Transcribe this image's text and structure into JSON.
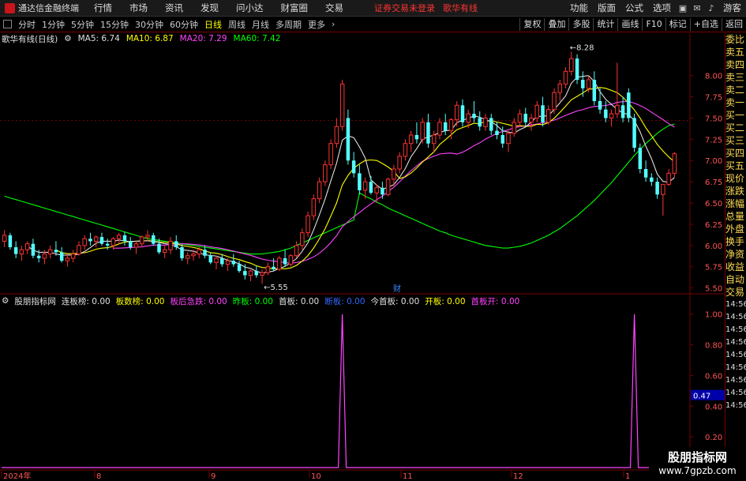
{
  "menubar": {
    "app_title": "通达信金融终端",
    "items": [
      "行情",
      "市场",
      "资讯",
      "发现",
      "问小达",
      "财富圈",
      "交易"
    ],
    "warning": "证券交易未登录",
    "product": "歌华有线",
    "right_items": [
      "功能",
      "版面",
      "公式",
      "选项"
    ],
    "guest": "游客"
  },
  "periodbar": {
    "periods": [
      "分时",
      "1分钟",
      "5分钟",
      "15分钟",
      "30分钟",
      "60分钟",
      "日线",
      "周线",
      "月线",
      "多周期",
      "更多"
    ],
    "active": "日线",
    "tools": [
      "复权",
      "叠加",
      "多股",
      "统计",
      "画线",
      "F10",
      "标记",
      "+自选",
      "返回"
    ]
  },
  "main_legend": {
    "title": "歌华有线(日线)",
    "ma5": "MA5: 6.74",
    "ma10": "MA10: 6.87",
    "ma20": "MA20: 7.29",
    "ma60": "MA60: 7.42"
  },
  "indicator_legend": {
    "title": "股朋指标网",
    "items": [
      {
        "label": "连板榜: 0.00",
        "color": "#e0e0e0"
      },
      {
        "label": "板数榜: 0.00",
        "color": "#ffff00"
      },
      {
        "label": "板后急跌: 0.00",
        "color": "#ff44ff"
      },
      {
        "label": "昨板: 0.00",
        "color": "#00ff00"
      },
      {
        "label": "首板: 0.00",
        "color": "#e0e0e0"
      },
      {
        "label": "断板: 0.00",
        "color": "#3366ff"
      },
      {
        "label": "今首板: 0.00",
        "color": "#e0e0e0"
      },
      {
        "label": "开板: 0.00",
        "color": "#ffff00"
      },
      {
        "label": "首板开: 0.00",
        "color": "#ff44ff"
      }
    ]
  },
  "price_axis": [
    "8.00",
    "7.75",
    "7.50",
    "7.25",
    "7.00",
    "6.75",
    "6.50",
    "6.25",
    "6.00",
    "5.75",
    "5.50"
  ],
  "indicator_axis": [
    "1.00",
    "0.80",
    "0.60",
    "0.40",
    "0.20"
  ],
  "indicator_current": "0.47",
  "date_axis": [
    "2024年",
    "8",
    "9",
    "10",
    "11",
    "12",
    "1"
  ],
  "annotations": {
    "high": "8.28",
    "low": "5.55",
    "event": "财"
  },
  "sidepanel": [
    "委比",
    "卖五",
    "卖四",
    "卖三",
    "卖二",
    "卖一",
    "买一",
    "买二",
    "买三",
    "买四",
    "买五",
    "现价",
    "涨跌",
    "涨幅",
    "总量",
    "外盘",
    "换手",
    "净资",
    "收益",
    "自动",
    "交易"
  ],
  "sidepanel_times": [
    "14:56",
    "14:56",
    "14:56",
    "14:56",
    "14:56",
    "14:56",
    "14:56",
    "14:56",
    "14:56"
  ],
  "watermark": {
    "line1": "股朋指标网",
    "line2": "www.7gpzb.com"
  },
  "colors": {
    "up": "#ff3333",
    "down": "#54ffff",
    "ma5": "#e0e0e0",
    "ma10": "#ffff00",
    "ma20": "#ff44ff",
    "ma60": "#00ff00",
    "signal": "#ff44ff",
    "frame": "#7a0000"
  },
  "chart_data": {
    "type": "candlestick",
    "price_range": [
      5.45,
      8.35
    ],
    "candles": [
      [
        6.05,
        6.18,
        5.98,
        6.12
      ],
      [
        6.12,
        6.15,
        5.95,
        5.98
      ],
      [
        5.98,
        6.05,
        5.85,
        5.9
      ],
      [
        5.9,
        6.0,
        5.82,
        5.95
      ],
      [
        5.95,
        6.05,
        5.9,
        6.02
      ],
      [
        6.02,
        6.08,
        5.85,
        5.88
      ],
      [
        5.88,
        5.95,
        5.8,
        5.85
      ],
      [
        5.85,
        5.95,
        5.78,
        5.9
      ],
      [
        5.9,
        6.0,
        5.85,
        5.95
      ],
      [
        5.95,
        6.05,
        5.88,
        5.92
      ],
      [
        5.92,
        5.98,
        5.8,
        5.82
      ],
      [
        5.82,
        5.9,
        5.75,
        5.85
      ],
      [
        5.85,
        5.95,
        5.8,
        5.9
      ],
      [
        5.9,
        6.05,
        5.88,
        6.0
      ],
      [
        6.0,
        6.12,
        5.95,
        6.08
      ],
      [
        6.08,
        6.15,
        6.0,
        6.05
      ],
      [
        6.05,
        6.12,
        5.98,
        6.1
      ],
      [
        6.1,
        6.15,
        6.0,
        6.02
      ],
      [
        6.02,
        6.08,
        5.95,
        6.0
      ],
      [
        6.0,
        6.1,
        5.95,
        6.08
      ],
      [
        6.08,
        6.15,
        6.02,
        6.12
      ],
      [
        6.12,
        6.16,
        6.0,
        6.05
      ],
      [
        6.05,
        6.1,
        5.95,
        5.98
      ],
      [
        5.98,
        6.05,
        5.9,
        6.02
      ],
      [
        6.02,
        6.12,
        5.98,
        6.1
      ],
      [
        6.1,
        6.18,
        6.05,
        6.12
      ],
      [
        6.12,
        6.15,
        6.0,
        6.02
      ],
      [
        6.02,
        6.08,
        5.9,
        5.92
      ],
      [
        5.92,
        6.0,
        5.85,
        5.95
      ],
      [
        5.95,
        6.1,
        5.9,
        6.05
      ],
      [
        6.05,
        6.12,
        5.95,
        5.98
      ],
      [
        5.98,
        6.02,
        5.82,
        5.85
      ],
      [
        5.85,
        5.92,
        5.78,
        5.88
      ],
      [
        5.88,
        5.95,
        5.82,
        5.9
      ],
      [
        5.9,
        5.98,
        5.85,
        5.95
      ],
      [
        5.95,
        6.0,
        5.85,
        5.88
      ],
      [
        5.88,
        5.92,
        5.78,
        5.8
      ],
      [
        5.8,
        5.88,
        5.72,
        5.85
      ],
      [
        5.85,
        5.9,
        5.75,
        5.78
      ],
      [
        5.78,
        5.85,
        5.7,
        5.82
      ],
      [
        5.82,
        5.9,
        5.75,
        5.78
      ],
      [
        5.78,
        5.82,
        5.68,
        5.7
      ],
      [
        5.7,
        5.78,
        5.6,
        5.65
      ],
      [
        5.65,
        5.72,
        5.58,
        5.7
      ],
      [
        5.7,
        5.76,
        5.62,
        5.65
      ],
      [
        5.65,
        5.72,
        5.55,
        5.68
      ],
      [
        5.68,
        5.8,
        5.65,
        5.75
      ],
      [
        5.75,
        5.85,
        5.7,
        5.72
      ],
      [
        5.72,
        5.88,
        5.7,
        5.85
      ],
      [
        5.85,
        5.95,
        5.75,
        5.78
      ],
      [
        5.78,
        5.9,
        5.75,
        5.88
      ],
      [
        5.88,
        6.05,
        5.85,
        6.0
      ],
      [
        6.0,
        6.2,
        5.95,
        6.15
      ],
      [
        6.15,
        6.4,
        6.1,
        6.35
      ],
      [
        6.35,
        6.6,
        6.3,
        6.55
      ],
      [
        6.55,
        6.8,
        6.5,
        6.75
      ],
      [
        6.75,
        7.0,
        6.7,
        6.95
      ],
      [
        6.95,
        7.25,
        6.9,
        7.2
      ],
      [
        7.2,
        7.5,
        7.15,
        7.4
      ],
      [
        7.4,
        7.95,
        7.35,
        7.9
      ],
      [
        7.5,
        7.6,
        6.95,
        7.0
      ],
      [
        7.0,
        7.1,
        6.8,
        6.85
      ],
      [
        6.85,
        6.95,
        6.6,
        6.65
      ],
      [
        6.65,
        6.8,
        6.55,
        6.75
      ],
      [
        6.75,
        6.82,
        6.6,
        6.62
      ],
      [
        6.62,
        6.72,
        6.5,
        6.68
      ],
      [
        6.68,
        6.75,
        6.55,
        6.6
      ],
      [
        6.6,
        6.8,
        6.58,
        6.78
      ],
      [
        6.78,
        6.95,
        6.7,
        6.9
      ],
      [
        6.9,
        7.1,
        6.85,
        7.05
      ],
      [
        7.05,
        7.25,
        7.0,
        7.2
      ],
      [
        7.2,
        7.35,
        7.1,
        7.3
      ],
      [
        7.3,
        7.45,
        7.2,
        7.25
      ],
      [
        7.25,
        7.5,
        7.2,
        7.45
      ],
      [
        7.45,
        7.55,
        7.15,
        7.2
      ],
      [
        7.2,
        7.35,
        7.1,
        7.3
      ],
      [
        7.3,
        7.5,
        7.25,
        7.45
      ],
      [
        7.45,
        7.55,
        7.3,
        7.35
      ],
      [
        7.35,
        7.5,
        7.25,
        7.48
      ],
      [
        7.48,
        7.7,
        7.4,
        7.65
      ],
      [
        7.65,
        7.72,
        7.4,
        7.45
      ],
      [
        7.45,
        7.6,
        7.38,
        7.55
      ],
      [
        7.55,
        7.7,
        7.45,
        7.5
      ],
      [
        7.5,
        7.58,
        7.35,
        7.4
      ],
      [
        7.4,
        7.55,
        7.35,
        7.5
      ],
      [
        7.5,
        7.55,
        7.3,
        7.35
      ],
      [
        7.35,
        7.45,
        7.25,
        7.3
      ],
      [
        7.3,
        7.4,
        7.15,
        7.2
      ],
      [
        7.2,
        7.35,
        7.1,
        7.32
      ],
      [
        7.32,
        7.5,
        7.28,
        7.45
      ],
      [
        7.45,
        7.6,
        7.4,
        7.55
      ],
      [
        7.55,
        7.62,
        7.4,
        7.45
      ],
      [
        7.45,
        7.55,
        7.35,
        7.5
      ],
      [
        7.5,
        7.7,
        7.45,
        7.65
      ],
      [
        7.65,
        7.75,
        7.4,
        7.45
      ],
      [
        7.45,
        7.65,
        7.42,
        7.6
      ],
      [
        7.6,
        7.85,
        7.55,
        7.8
      ],
      [
        7.8,
        7.95,
        7.7,
        7.9
      ],
      [
        7.9,
        8.1,
        7.85,
        8.05
      ],
      [
        8.05,
        8.28,
        8.0,
        8.2
      ],
      [
        8.2,
        8.25,
        7.9,
        7.95
      ],
      [
        7.95,
        8.05,
        7.75,
        7.85
      ],
      [
        7.85,
        8.0,
        7.8,
        7.95
      ],
      [
        7.95,
        8.05,
        7.65,
        7.7
      ],
      [
        7.7,
        7.85,
        7.55,
        7.6
      ],
      [
        7.6,
        7.7,
        7.45,
        7.5
      ],
      [
        7.5,
        7.6,
        7.4,
        7.55
      ],
      [
        7.55,
        8.15,
        7.5,
        7.65
      ],
      [
        7.65,
        7.75,
        7.45,
        7.5
      ],
      [
        7.8,
        7.85,
        7.45,
        7.5
      ],
      [
        7.5,
        7.55,
        7.1,
        7.15
      ],
      [
        7.15,
        7.2,
        6.85,
        6.9
      ],
      [
        6.9,
        7.0,
        6.75,
        6.8
      ],
      [
        6.8,
        6.85,
        6.7,
        6.75
      ],
      [
        6.75,
        6.8,
        6.55,
        6.6
      ],
      [
        6.6,
        6.65,
        6.35,
        6.72
      ],
      [
        6.72,
        6.9,
        6.7,
        6.85
      ],
      [
        6.85,
        7.1,
        6.8,
        7.08
      ]
    ],
    "ma60": [
      6.62,
      6.58,
      6.55,
      6.51,
      6.48,
      6.44,
      6.41,
      6.38,
      6.35,
      6.32,
      6.29,
      6.26,
      6.23,
      6.2,
      6.17,
      6.15,
      6.12,
      6.1,
      6.08,
      6.06,
      6.04,
      6.02,
      6.0,
      5.99,
      5.98,
      5.97,
      5.97,
      5.98,
      5.99,
      6.01,
      6.03,
      6.06,
      6.09,
      6.12,
      6.16,
      6.2,
      6.25,
      6.3,
      6.35,
      6.41,
      6.47,
      6.53,
      6.6,
      6.67,
      6.74,
      6.82,
      6.9,
      6.98,
      7.06,
      7.13,
      7.2,
      7.26,
      7.32,
      7.37,
      7.41,
      7.43,
      7.44,
      7.44,
      7.43
    ],
    "ma60_start_index": 62,
    "signal_spikes": [
      {
        "index": 59,
        "value": 1.0
      },
      {
        "index": 110,
        "value": 1.0
      }
    ],
    "indicator_range": [
      0,
      1.05
    ]
  }
}
